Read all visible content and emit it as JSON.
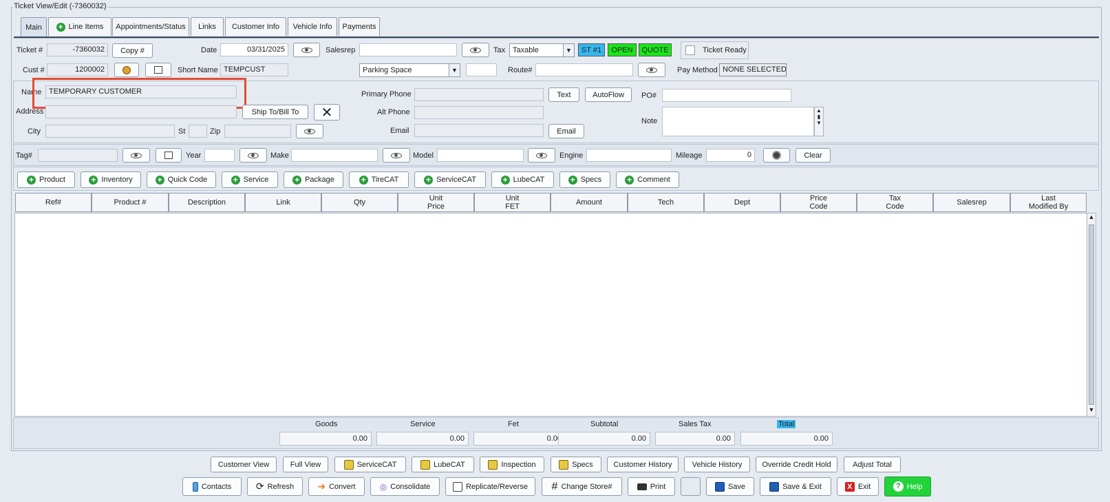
{
  "window": {
    "title": "Ticket View/Edit  (-7360032)"
  },
  "tabs": [
    {
      "label": "Main",
      "active": true
    },
    {
      "label": "Line Items",
      "icon": "plus-icon"
    },
    {
      "label": "Appointments/Status"
    },
    {
      "label": "Links"
    },
    {
      "label": "Customer Info"
    },
    {
      "label": "Vehicle Info"
    },
    {
      "label": "Payments"
    }
  ],
  "header": {
    "ticket_label": "Ticket #",
    "ticket_value": "-7360032",
    "copy_label": "Copy #",
    "date_label": "Date",
    "date_value": "03/31/2025",
    "salesrep_label": "Salesrep",
    "salesrep_value": "",
    "tax_label": "Tax",
    "tax_value": "Taxable",
    "badges": {
      "store": "ST #1",
      "open": "OPEN",
      "quote": "QUOTE"
    },
    "ticket_ready_label": "Ticket Ready",
    "cust_label": "Cust #",
    "cust_value": "1200002",
    "short_name_label": "Short Name",
    "short_name_value": "TEMPCUST",
    "parking_value": "Parking Space",
    "parking_extra": "",
    "route_label": "Route#",
    "route_value": "",
    "pay_method_label": "Pay Method",
    "pay_method_value": "NONE SELECTED"
  },
  "customer": {
    "name_label": "Name",
    "name_value": "TEMPORARY CUSTOMER",
    "address_label": "Address",
    "address_value": "",
    "ship_to_label": "Ship To/Bill To",
    "city_label": "City",
    "st_label": "St",
    "zip_label": "Zip",
    "primary_phone_label": "Primary Phone",
    "text_label": "Text",
    "autoflow_label": "AutoFlow",
    "alt_phone_label": "Alt Phone",
    "email_label": "Email",
    "email_button": "Email",
    "po_label": "PO#",
    "note_label": "Note"
  },
  "vehicle": {
    "tag_label": "Tag#",
    "year_label": "Year",
    "make_label": "Make",
    "model_label": "Model",
    "engine_label": "Engine",
    "mileage_label": "Mileage",
    "mileage_value": "0",
    "clear_label": "Clear"
  },
  "add_buttons": [
    "Product",
    "Inventory",
    "Quick Code",
    "Service",
    "Package",
    "TireCAT",
    "ServiceCAT",
    "LubeCAT",
    "Specs",
    "Comment"
  ],
  "grid": {
    "columns": [
      "Ref#",
      "Product #",
      "Description",
      "Link",
      "Qty",
      "Unit\nPrice",
      "Unit\nFET",
      "Amount",
      "Tech",
      "Dept",
      "Price\nCode",
      "Tax\nCode",
      "Salesrep",
      "Last\nModified By"
    ]
  },
  "totals": {
    "goods_label": "Goods",
    "goods_value": "0.00",
    "service_label": "Service",
    "service_value": "0.00",
    "fet_label": "Fet",
    "fet_value": "0.00",
    "subtotal_label": "Subtotal",
    "subtotal_value": "0.00",
    "sales_tax_label": "Sales Tax",
    "sales_tax_value": "0.00",
    "total_label": "Total",
    "total_value": "0.00"
  },
  "footer_row1": [
    "Customer View",
    "Full View",
    "ServiceCAT",
    "LubeCAT",
    "Inspection",
    "Specs",
    "Customer History",
    "Vehicle History",
    "Override Credit Hold",
    "Adjust Total"
  ],
  "footer_row2": [
    "Contacts",
    "Refresh",
    "Convert",
    "Consolidate",
    "Replicate/Reverse",
    "Change Store#",
    "Print",
    "",
    "Save",
    "Save & Exit",
    "Exit",
    "Help"
  ],
  "colors": {
    "accent_blue": "#35b8ef",
    "green": "#19e619",
    "highlight_red": "#e64a33",
    "help_green": "#22d33a"
  }
}
